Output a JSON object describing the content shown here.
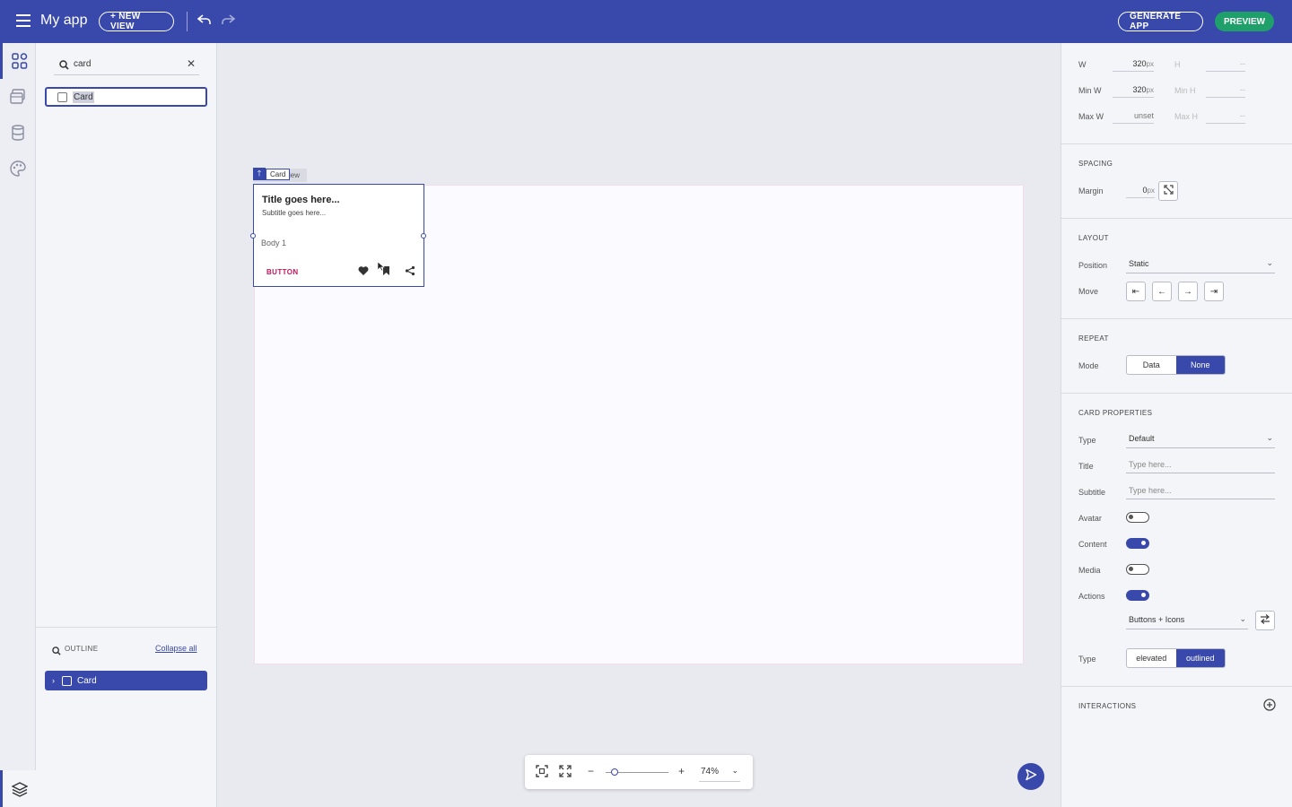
{
  "topbar": {
    "app_title": "My app",
    "new_view_label": "+ NEW VIEW",
    "generate_label": "GENERATE APP",
    "preview_label": "PREVIEW"
  },
  "left_panel": {
    "search_value": "card",
    "result_label": "Card",
    "outline_label": "OUTLINE",
    "collapse_all_label": "Collapse all",
    "outline_item_label": "Card"
  },
  "canvas": {
    "selection_tag": "Card",
    "underlying_tag": "iew",
    "card": {
      "title": "Title goes here...",
      "subtitle": "Subtitle goes here...",
      "body": "Body 1",
      "button": "BUTTON"
    },
    "zoom_value": "74%",
    "zoom_level_fraction": 0.14
  },
  "right_panel": {
    "w_label": "W",
    "w_value": "320",
    "w_unit": "px",
    "h_label": "H",
    "h_value": "--",
    "min_w_label": "Min W",
    "min_w_value": "320",
    "min_w_unit": "px",
    "min_h_label": "Min H",
    "min_h_value": "--",
    "max_w_label": "Max W",
    "max_w_value": "unset",
    "max_h_label": "Max H",
    "max_h_value": "--",
    "spacing_title": "SPACING",
    "margin_label": "Margin",
    "margin_value": "0",
    "margin_unit": "px",
    "layout_title": "LAYOUT",
    "position_label": "Position",
    "position_value": "Static",
    "move_label": "Move",
    "repeat_title": "REPEAT",
    "mode_label": "Mode",
    "mode_options": [
      "Data",
      "None"
    ],
    "mode_selected": "None",
    "card_props_title": "CARD PROPERTIES",
    "type_label": "Type",
    "type_value": "Default",
    "title_label": "Title",
    "title_placeholder": "Type here...",
    "subtitle_label": "Subtitle",
    "subtitle_placeholder": "Type here...",
    "avatar_label": "Avatar",
    "avatar_on": false,
    "content_label": "Content",
    "content_on": true,
    "media_label": "Media",
    "media_on": false,
    "actions_label": "Actions",
    "actions_on": true,
    "actions_variant": "Buttons + Icons",
    "variant_type_label": "Type",
    "variant_options": [
      "elevated",
      "outlined"
    ],
    "variant_selected": "outlined",
    "interactions_title": "INTERACTIONS"
  },
  "colors": {
    "primary": "#3949ab",
    "preview_green": "#1fa06b",
    "button_text": "#c2185b"
  }
}
